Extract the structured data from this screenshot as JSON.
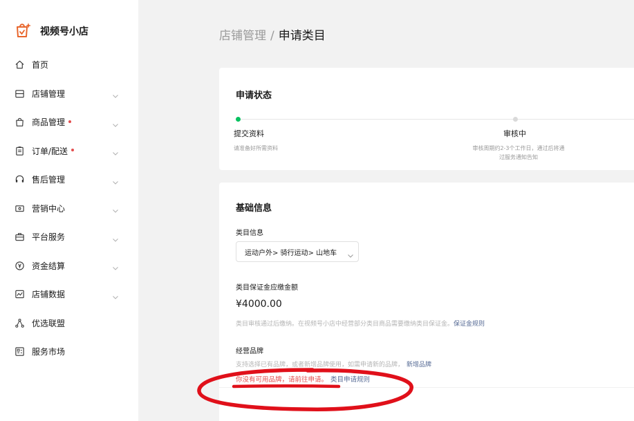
{
  "app": {
    "name": "视频号小店"
  },
  "sidebar": {
    "items": [
      {
        "label": "首页",
        "icon": "home-icon",
        "has_dot": false,
        "has_chevron": false
      },
      {
        "label": "店铺管理",
        "icon": "store-icon",
        "has_dot": false,
        "has_chevron": true
      },
      {
        "label": "商品管理",
        "icon": "bag-icon",
        "has_dot": true,
        "has_chevron": true
      },
      {
        "label": "订单/配送",
        "icon": "clipboard-icon",
        "has_dot": true,
        "has_chevron": true
      },
      {
        "label": "售后管理",
        "icon": "headset-icon",
        "has_dot": false,
        "has_chevron": true
      },
      {
        "label": "营销中心",
        "icon": "ticket-icon",
        "has_dot": false,
        "has_chevron": true
      },
      {
        "label": "平台服务",
        "icon": "briefcase-icon",
        "has_dot": false,
        "has_chevron": true
      },
      {
        "label": "资金结算",
        "icon": "yen-icon",
        "has_dot": false,
        "has_chevron": true
      },
      {
        "label": "店铺数据",
        "icon": "chart-icon",
        "has_dot": false,
        "has_chevron": true
      },
      {
        "label": "优选联盟",
        "icon": "network-icon",
        "has_dot": false,
        "has_chevron": false
      },
      {
        "label": "服务市场",
        "icon": "grid-icon",
        "has_dot": false,
        "has_chevron": false
      }
    ]
  },
  "breadcrumb": {
    "parent": "店铺管理",
    "separator": "/",
    "current": "申请类目"
  },
  "status_card": {
    "title": "申请状态",
    "steps": [
      {
        "title": "提交资料",
        "desc": "请准备好所需资料",
        "state": "done"
      },
      {
        "title": "审核中",
        "desc_line1": "审核周期约2-3个工作日，通过后将通",
        "desc_line2": "过服务通知告知",
        "state": "pending"
      }
    ]
  },
  "basic_card": {
    "title": "基础信息",
    "category_label": "类目信息",
    "category_value": "运动户外> 骑行运动> 山地车",
    "deposit_label": "类目保证金应缴金额",
    "deposit_amount": "¥4000.00",
    "deposit_hint": "类目审核通过后缴纳。在视频号小店中经营部分类目商品需要缴纳类目保证金。",
    "deposit_link": "保证金规则",
    "brand_label": "经营品牌",
    "brand_hint": "支持选择已有品牌，或者新增品牌使用，如需申请新的品牌，",
    "brand_add_link": "新增品牌",
    "brand_warning": "你没有可用品牌，请前往申请。",
    "brand_rule_link": "类目申请规则"
  },
  "colors": {
    "accent_green": "#07c160",
    "warning_red": "#e34d4d",
    "link_blue": "#576b95",
    "annotation_red": "#e0101a"
  }
}
